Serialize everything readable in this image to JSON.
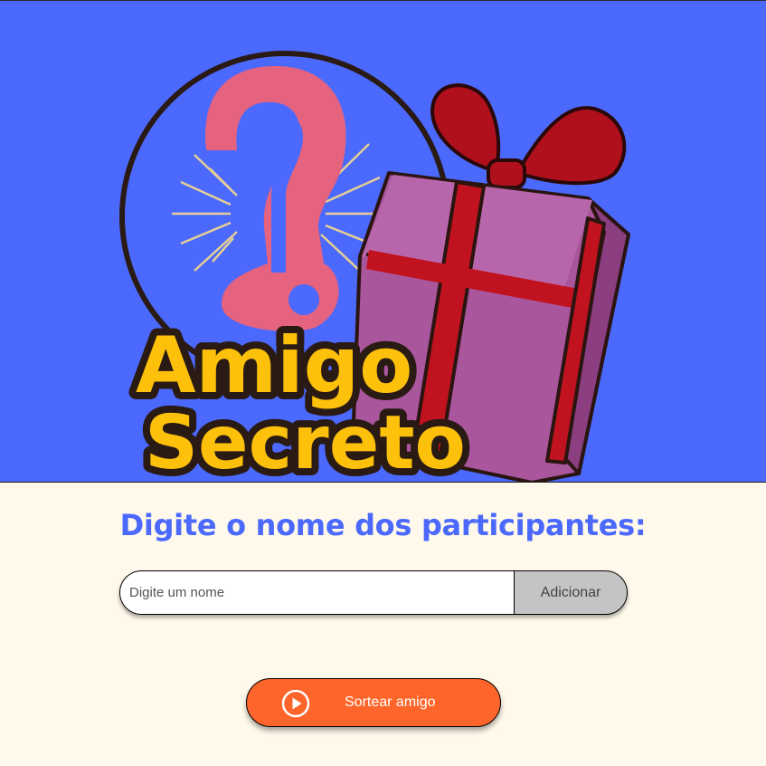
{
  "colors": {
    "header_bg": "#4B69FD",
    "page_bg": "#FFF9EB",
    "title": "#4B69FD",
    "add_button_bg": "#C4C4C4",
    "draw_button_bg": "#FE652B",
    "logo_text": "#FDC10C",
    "gift_box": "#A9569C",
    "ribbon": "#B9101C",
    "question_mark": "#E5637E"
  },
  "header": {
    "logo_line1": "Amigo",
    "logo_line2": "Secreto",
    "logo_icons": [
      "question-mark-icon",
      "gift-box-icon"
    ]
  },
  "main": {
    "title": "Digite o nome dos participantes:",
    "name_input": {
      "placeholder": "Digite um nome",
      "value": ""
    },
    "add_button_label": "Adicionar",
    "draw_button": {
      "label": "Sortear amigo",
      "icon": "play-circle-icon"
    }
  }
}
